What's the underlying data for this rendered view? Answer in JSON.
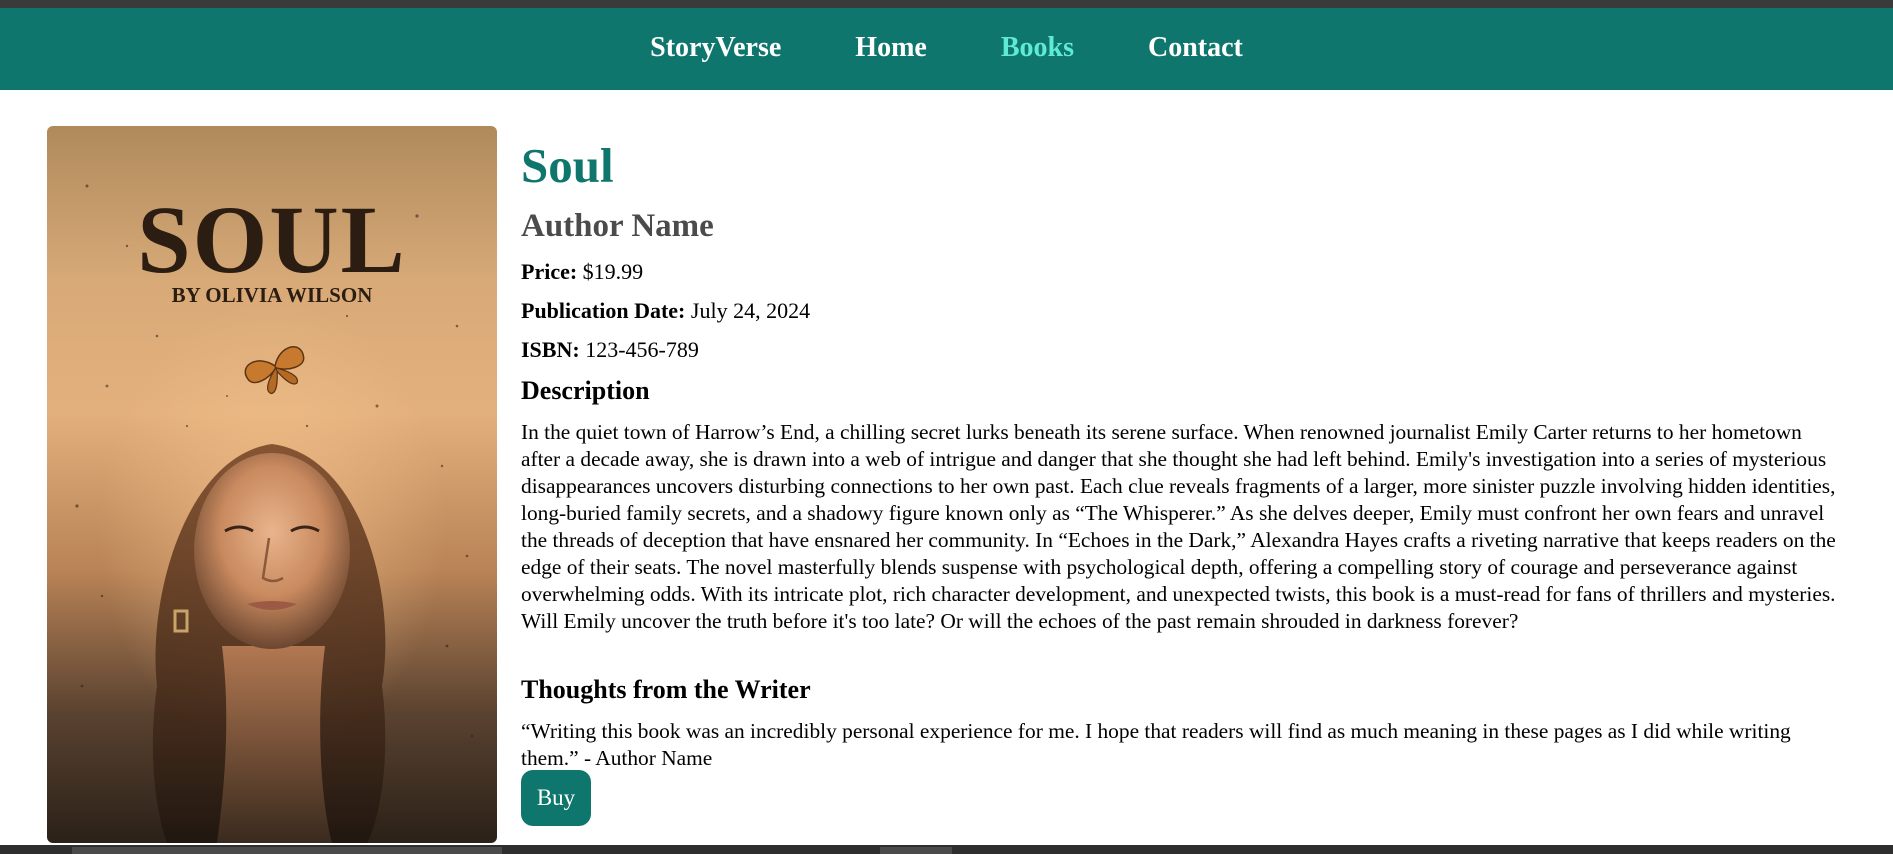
{
  "nav": {
    "brand": "StoryVerse",
    "links": [
      "Home",
      "Books",
      "Contact"
    ],
    "active": "Books"
  },
  "cover": {
    "title": "SOUL",
    "author": "BY OLIVIA WILSON"
  },
  "book": {
    "title": "Soul",
    "author": "Author Name",
    "price_label": "Price:",
    "price": "$19.99",
    "pubdate_label": "Publication Date:",
    "pubdate": "July 24, 2024",
    "isbn_label": "ISBN:",
    "isbn": "123-456-789"
  },
  "description": {
    "heading": "Description",
    "text": "In the quiet town of Harrow’s End, a chilling secret lurks beneath its serene surface. When renowned journalist Emily Carter returns to her hometown after a decade away, she is drawn into a web of intrigue and danger that she thought she had left behind. Emily's investigation into a series of mysterious disappearances uncovers disturbing connections to her own past. Each clue reveals fragments of a larger, more sinister puzzle involving hidden identities, long-buried family secrets, and a shadowy figure known only as “The Whisperer.” As she delves deeper, Emily must confront her own fears and unravel the threads of deception that have ensnared her community. In “Echoes in the Dark,” Alexandra Hayes crafts a riveting narrative that keeps readers on the edge of their seats. The novel masterfully blends suspense with psychological depth, offering a compelling story of courage and perseverance against overwhelming odds. With its intricate plot, rich character development, and unexpected twists, this book is a must-read for fans of thrillers and mysteries. Will Emily uncover the truth before it's too late? Or will the echoes of the past remain shrouded in darkness forever?"
  },
  "thoughts": {
    "heading": "Thoughts from the Writer",
    "text": "“Writing this book was an incredibly personal experience for me. I hope that readers will find as much meaning in these pages as I did while writing them.” - Author Name"
  },
  "buy_label": "Buy",
  "colors": {
    "accent": "#0f766e",
    "active_link": "#5eead4",
    "author_gray": "#4b4b4b"
  }
}
